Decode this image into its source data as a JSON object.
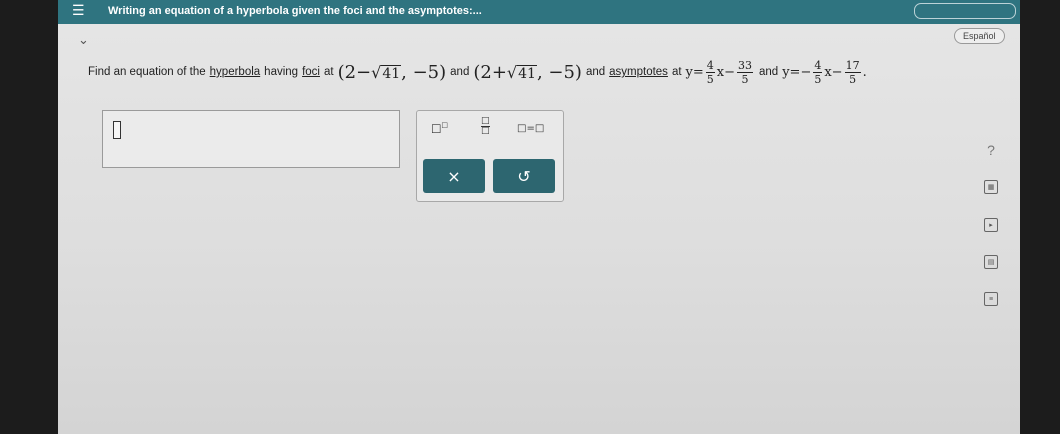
{
  "header": {
    "title": "Writing an equation of a hyperbola given the foci and the asymptotes:..."
  },
  "toolbar": {
    "language_label": "Español"
  },
  "problem": {
    "prefix": "Find an equation of the",
    "term_hyperbola": "hyperbola",
    "having": "having",
    "term_foci": "foci",
    "at": "at",
    "focus1": {
      "open": "(2−",
      "radicand": "41",
      "close": ", −5)"
    },
    "and1": "and",
    "focus2": {
      "open": "(2+",
      "radicand": "41",
      "close": ", −5)"
    },
    "and2": "and",
    "term_asymptotes": "asymptotes",
    "at2": "at",
    "asymptote1": {
      "lhs": "y=",
      "coef_num": "4",
      "coef_den": "5",
      "mid": "x−",
      "const_num": "33",
      "const_den": "5"
    },
    "and3": "and",
    "asymptote2": {
      "lhs": "y=−",
      "coef_num": "4",
      "coef_den": "5",
      "mid": "x−",
      "const_num": "17",
      "const_den": "5"
    },
    "end": "."
  },
  "keypad": {
    "exp_base": "□",
    "exp_sup": "□",
    "frac_num": "□",
    "frac_den": "□",
    "equation_label": "□=□",
    "clear_label": "×",
    "undo_label": "↺"
  },
  "side": {
    "help_label": "?"
  }
}
